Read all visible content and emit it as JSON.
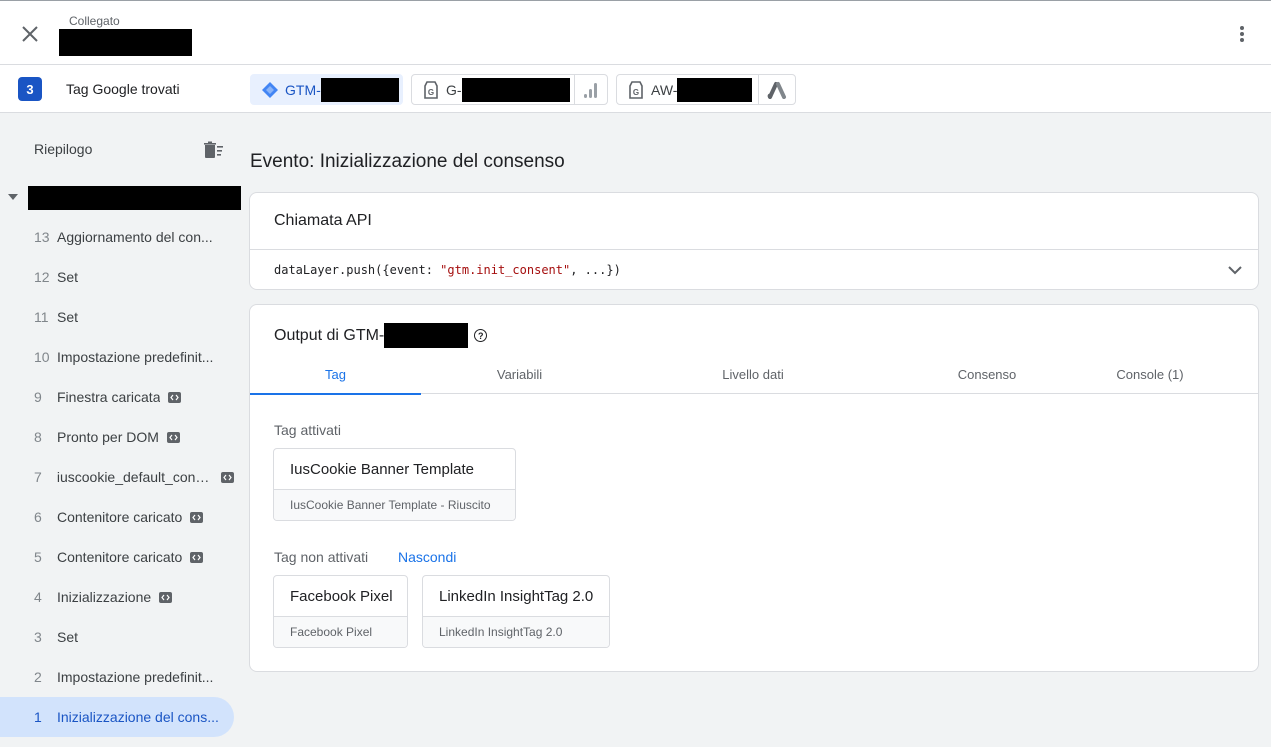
{
  "header": {
    "connection_label": "Collegato"
  },
  "tagbar": {
    "count": "3",
    "found_label": "Tag Google trovati",
    "chips": [
      {
        "prefix": "GTM-",
        "icon": "gtm-diamond-icon",
        "active": true
      },
      {
        "prefix": "G-",
        "icon": "analytics-bars-icon",
        "active": false
      },
      {
        "prefix": "AW-",
        "icon": "google-ads-icon",
        "active": false
      }
    ]
  },
  "sidebar": {
    "title": "Riepilogo",
    "events": [
      {
        "num": "13",
        "label": "Aggiornamento del con...",
        "code": false
      },
      {
        "num": "12",
        "label": "Set",
        "code": false
      },
      {
        "num": "11",
        "label": "Set",
        "code": false
      },
      {
        "num": "10",
        "label": "Impostazione predefinit...",
        "code": false
      },
      {
        "num": "9",
        "label": "Finestra caricata",
        "code": true
      },
      {
        "num": "8",
        "label": "Pronto per DOM",
        "code": true
      },
      {
        "num": "7",
        "label": "iuscookie_default_cons...",
        "code": true
      },
      {
        "num": "6",
        "label": "Contenitore caricato",
        "code": true
      },
      {
        "num": "5",
        "label": "Contenitore caricato",
        "code": true
      },
      {
        "num": "4",
        "label": "Inizializzazione",
        "code": true
      },
      {
        "num": "3",
        "label": "Set",
        "code": false
      },
      {
        "num": "2",
        "label": "Impostazione predefinit...",
        "code": false
      },
      {
        "num": "1",
        "label": "Inizializzazione del cons...",
        "code": false
      }
    ]
  },
  "main": {
    "title": "Evento: Inizializzazione del consenso",
    "api_card": {
      "title": "Chiamata API",
      "code_prefix": "dataLayer.push({event: ",
      "code_string": "\"gtm.init_consent\"",
      "code_suffix": ", ...})"
    },
    "output_card": {
      "title_prefix": "Output di GTM-",
      "tabs": [
        "Tag",
        "Variabili",
        "Livello dati",
        "Consenso",
        "Console (1)"
      ],
      "fired_label": "Tag attivati",
      "fired_tags": [
        {
          "name": "IusCookie Banner Template",
          "status": "IusCookie Banner Template - Riuscito"
        }
      ],
      "not_fired_label": "Tag non attivati",
      "hide_label": "Nascondi",
      "not_fired_tags": [
        {
          "name": "Facebook Pixel",
          "status": "Facebook Pixel"
        },
        {
          "name": "LinkedIn InsightTag 2.0",
          "status": "LinkedIn InsightTag 2.0"
        }
      ]
    }
  }
}
